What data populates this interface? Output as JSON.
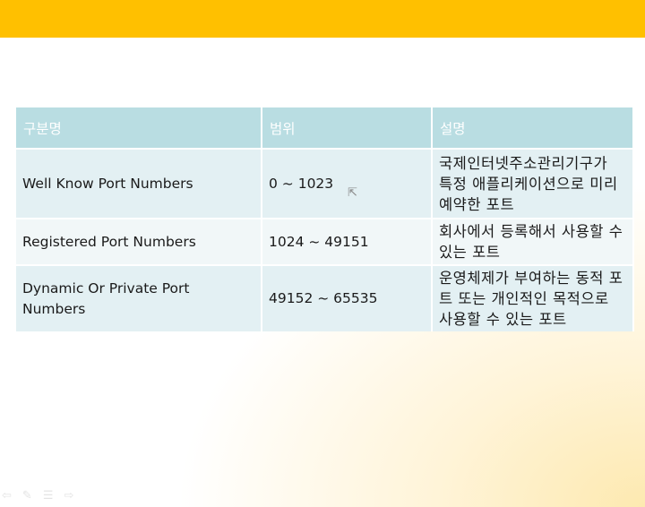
{
  "slide": {
    "accent_color": "#ffc000",
    "header_color": "#b9dde2",
    "table": {
      "headers": [
        "구분명",
        "범위",
        "설명"
      ],
      "rows": [
        {
          "name": "Well Know Port Numbers",
          "range": "0 ~ 1023",
          "desc": "국제인터넷주소관리기구가 특정 애플리케이션으로 미리 예약한 포트"
        },
        {
          "name": "Registered Port Numbers",
          "range": "1024 ~ 49151",
          "desc": "회사에서 등록해서 사용할 수 있는 포트"
        },
        {
          "name": "Dynamic Or Private Port Numbers",
          "range": "49152 ~ 65535",
          "desc": "운영체제가 부여하는 동적 포트 또는 개인적인 목적으로 사용할 수 있는 포트"
        }
      ]
    }
  },
  "nav": {
    "icons": [
      "back-arrow-icon",
      "pen-icon",
      "menu-icon",
      "forward-arrow-icon"
    ]
  }
}
